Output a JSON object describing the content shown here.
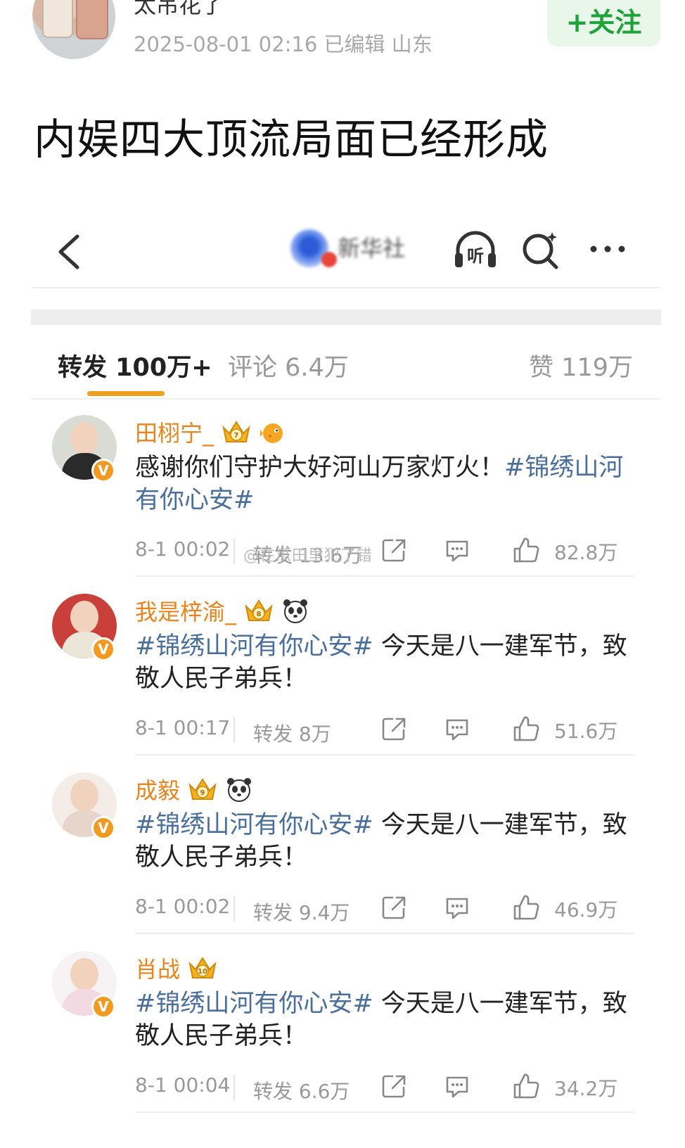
{
  "post": {
    "username": "太吊花了",
    "meta": "2025-08-01 02:16  已编辑  山东",
    "follow_label": "+关注",
    "title": "内娱四大顶流局面已经形成"
  },
  "nav": {
    "account_name": "新华社"
  },
  "tabs": {
    "repost": "转发 100万+",
    "comment": "评论 6.4万",
    "like": "赞 119万"
  },
  "reposts": [
    {
      "name": "田栩宁_",
      "crown_level": "7",
      "emoji": "pufferfish",
      "text": "感谢你们守护大好河山万家灯火！",
      "hashtag": "#锦绣山河有你心安#",
      "hashtag_first": false,
      "time": "8-1 00:02",
      "repost_count": "转发 13.6万",
      "likes": "82.8万"
    },
    {
      "name": "我是梓渝_",
      "crown_level": "8",
      "emoji": "panda",
      "text": " 今天是八一建军节，致敬人民子弟兵！",
      "hashtag": "#锦绣山河有你心安#",
      "hashtag_first": true,
      "time": "8-1 00:17",
      "repost_count": "转发 8万",
      "likes": "51.6万"
    },
    {
      "name": "成毅",
      "crown_level": "9",
      "emoji": "panda",
      "text": " 今天是八一建军节，致敬人民子弟兵！",
      "hashtag": "#锦绣山河有你心安#",
      "hashtag_first": true,
      "time": "8-1 00:02",
      "repost_count": "转发 9.4万",
      "likes": "46.9万"
    },
    {
      "name": "肖战",
      "crown_level": "10",
      "emoji": "",
      "text": " 今天是八一建军节，致敬人民子弟兵！",
      "hashtag": "#锦绣山河有你心安#",
      "hashtag_first": true,
      "time": "8-1 00:04",
      "repost_count": "转发 6.6万",
      "likes": "34.2万"
    }
  ],
  "watermark": "@在瓜田里犯了错",
  "colors": {
    "follow_green": "#1fa239",
    "name_orange": "#e8841e",
    "hashtag_blue": "#4a6f9d",
    "tab_underline": "#f0a020"
  }
}
